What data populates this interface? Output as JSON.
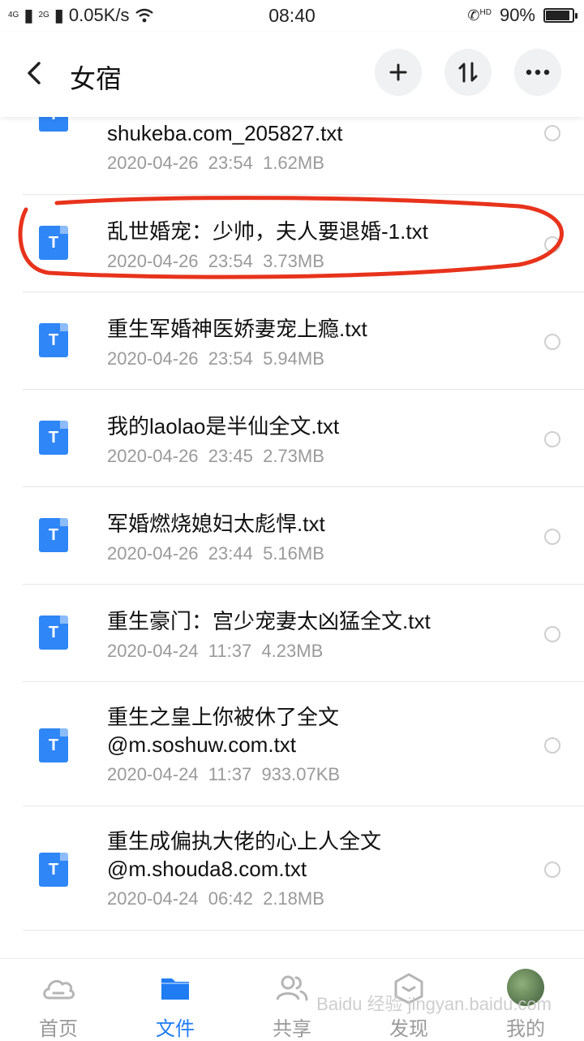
{
  "status": {
    "network_1": "4G",
    "network_2": "2G",
    "speed": "0.05K/s",
    "time": "08:40",
    "hd": "HD",
    "battery": "90%",
    "battery_level": 0.9
  },
  "header": {
    "title": "女宿",
    "icons": [
      "back-icon",
      "plus-icon",
      "sort-icon",
      "more-icon"
    ]
  },
  "files": [
    {
      "name": "shukeba.com_205827.txt",
      "date": "2020-04-26",
      "time": "23:54",
      "size": "1.62MB",
      "icon_letter": "T"
    },
    {
      "name": "乱世婚宠：少帅，夫人要退婚-1.txt",
      "date": "2020-04-26",
      "time": "23:54",
      "size": "3.73MB",
      "icon_letter": "T"
    },
    {
      "name": "重生军婚神医娇妻宠上瘾.txt",
      "date": "2020-04-26",
      "time": "23:54",
      "size": "5.94MB",
      "icon_letter": "T"
    },
    {
      "name": "我的laolao是半仙全文.txt",
      "date": "2020-04-26",
      "time": "23:45",
      "size": "2.73MB",
      "icon_letter": "T"
    },
    {
      "name": "军婚燃烧媳妇太彪悍.txt",
      "date": "2020-04-26",
      "time": "23:44",
      "size": "5.16MB",
      "icon_letter": "T"
    },
    {
      "name": "重生豪门：宫少宠妻太凶猛全文.txt",
      "date": "2020-04-24",
      "time": "11:37",
      "size": "4.23MB",
      "icon_letter": "T"
    },
    {
      "name_line1": "重生之皇上你被休了全文",
      "name_line2": "@m.soshuw.com.txt",
      "date": "2020-04-24",
      "time": "11:37",
      "size": "933.07KB",
      "icon_letter": "T"
    },
    {
      "name_line1": "重生成偏执大佬的心上人全文",
      "name_line2": "@m.shouda8.com.txt",
      "date": "2020-04-24",
      "time": "06:42",
      "size": "2.18MB",
      "icon_letter": "T"
    }
  ],
  "tabs": [
    {
      "label": "首页",
      "icon": "cloud-icon"
    },
    {
      "label": "文件",
      "icon": "folder-icon"
    },
    {
      "label": "共享",
      "icon": "users-icon"
    },
    {
      "label": "发现",
      "icon": "discover-icon"
    },
    {
      "label": "我的",
      "icon": "avatar"
    }
  ],
  "watermark": "Baidu 经验 jingyan.baidu.com",
  "colors": {
    "accent": "#1f7cf3",
    "file_icon": "#2f86f6",
    "highlight": "#e8331c"
  }
}
